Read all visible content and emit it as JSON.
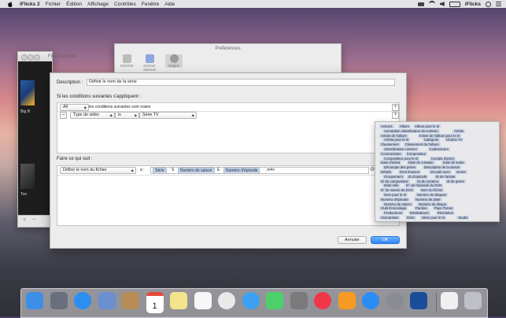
{
  "menubar": {
    "app": "iFlicks 2",
    "items": [
      "Fichier",
      "Édition",
      "Affichage",
      "Contrôles",
      "Fenêtre",
      "Aide"
    ],
    "status_app": "iFlicks"
  },
  "queue_window": {
    "title": "File d'attente",
    "film_caption_1": "Big B",
    "film_caption_2": "Too",
    "footer_add": "+",
    "footer_remove": "−"
  },
  "prefs_window": {
    "title": "Préférences",
    "tabs": [
      "Général",
      "Dossier observé",
      "Règles"
    ]
  },
  "sheet": {
    "description_label": "Description :",
    "description_value": "Définir le nom de la série",
    "conditions_heading": "Si les conditions suivantes s'appliquent :",
    "match_popup": "All",
    "match_text": "les conditions suivantes sont vraies",
    "cond_field": "Type de vidéo",
    "cond_op": "is",
    "cond_value": "Série TV",
    "actions_heading": "Faire ce qui suit :",
    "action_popup": "Définir le nom du fichier",
    "to_label": "à :",
    "tokens": [
      "Série",
      "S",
      "Numéro de saison",
      "E",
      "Numéro d'épisode",
      ".m4v"
    ],
    "cancel": "Annuler",
    "ok": "OK"
  },
  "palette": {
    "rows": [
      [
        "Acteurs",
        "Album",
        "Album pour le tri"
      ],
      [
        "Annotation classification du contenu",
        "Artiste"
      ],
      [
        "Artiste de l'album",
        "Artiste de l'album pour le tri"
      ],
      [
        "Artiste pour le tri",
        "Catégorie",
        "Chaîne TV"
      ],
      [
        "Classement",
        "Classement de l'album"
      ],
      [
        "Classification contenu",
        "Codirecteurs"
      ],
      [
        "Commentaire",
        "Compositeur"
      ],
      [
        "Compositeur pour le tri",
        "Compte d'Ipres"
      ],
      [
        "Date d'achat",
        "Date de création",
        "Date de sortie"
      ],
      [
        "Décompte des pistes",
        "Description de la saison"
      ],
      [
        "Détails",
        "Droit d'auteur",
        "Encodé avec",
        "Genre"
      ],
      [
        "Groupement",
        "ID d'épisode",
        "ID de l'artiste"
      ],
      [
        "ID du compositeur",
        "ID du contenu",
        "ID de genre"
      ],
      [
        "Mots-clés",
        "N° de l'épisode du DVD"
      ],
      [
        "N° de saison du DVD",
        "Nom du fichier"
      ],
      [
        "Nom pour le tri",
        "Numéro de disques"
      ],
      [
        "Numéro d'épisode",
        "Numéro de piste"
      ],
      [
        "Numéro de saison",
        "Numéro du disque"
      ],
      [
        "Outil d'encodage",
        "Paroles",
        "Pays iTunes"
      ],
      [
        "Producteurs",
        "Réalisateurs",
        "Résolution"
      ],
      [
        "Scénaristes",
        "Série",
        "Série pour le tri",
        "Studio"
      ]
    ]
  },
  "dock": {
    "apps": [
      "Finder",
      "Launchpad",
      "Safari",
      "Aperçu",
      "Contacts",
      "Calendrier",
      "Notes",
      "Rappels",
      "Photos",
      "Messages",
      "FaceTime",
      "Photo Booth",
      "iTunes",
      "iBooks",
      "App Store",
      "Préférences Système",
      "iFlicks",
      "Documents",
      "Corbeille"
    ],
    "calendar_day": "1"
  }
}
